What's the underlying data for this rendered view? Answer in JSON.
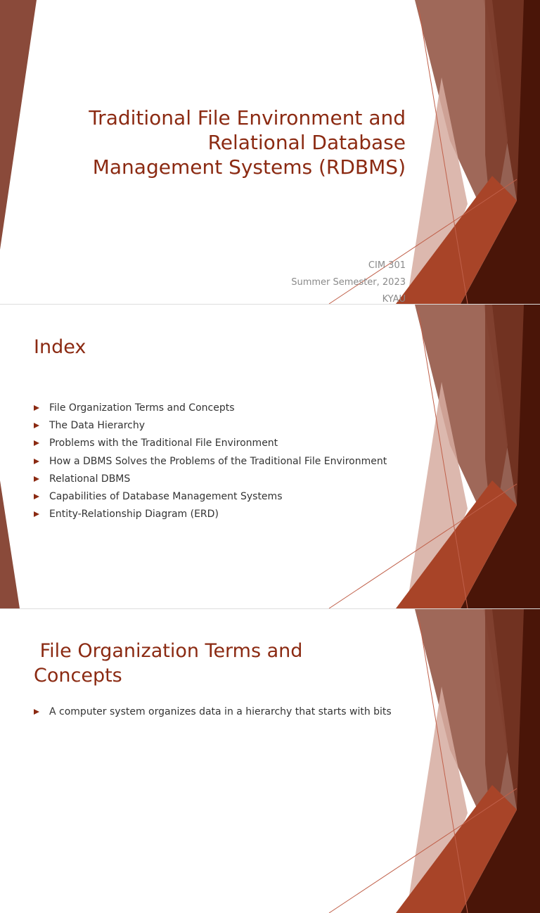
{
  "slide1": {
    "title_lines": [
      "Traditional File Environment and",
      "Relational Database",
      "Management Systems (RDBMS)"
    ],
    "subtitle": [
      "CIM 301",
      "Summer Semester, 2023",
      "KYAU"
    ]
  },
  "slide2": {
    "title": "Index",
    "items": [
      "File Organization Terms and Concepts",
      "The Data Hierarchy",
      "Problems with the Traditional File Environment",
      "How a DBMS Solves the Problems of the Traditional File Environment",
      "Relational DBMS",
      "Capabilities of Database Management Systems",
      "Entity-Relationship Diagram (ERD)"
    ]
  },
  "slide3": {
    "title": " File Organization Terms and\nConcepts",
    "items": [
      "A computer system organizes data in a hierarchy that starts with bits"
    ]
  },
  "colors": {
    "accent": "#8b2a12",
    "dark": "#4a1508"
  }
}
